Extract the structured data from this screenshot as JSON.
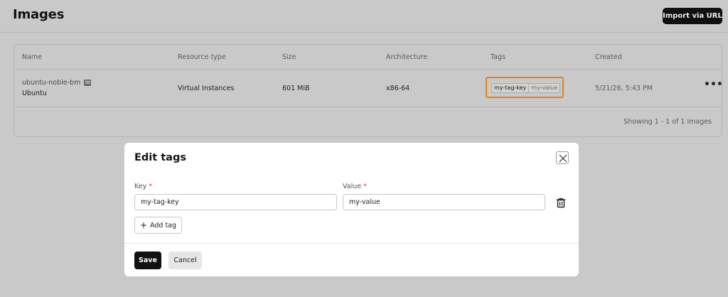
{
  "header": {
    "title": "Images",
    "import_button": "Import via URL"
  },
  "table": {
    "columns": [
      "Name",
      "Resource type",
      "Size",
      "Architecture",
      "Tags",
      "Created"
    ],
    "rows": [
      {
        "name": "ubuntu-noble-bm",
        "id_icon": "ID",
        "subtitle": "Ubuntu",
        "resource_type": "Virtual Instances",
        "size": "601 MiB",
        "architecture": "x86-64",
        "tag_key": "my-tag-key",
        "tag_value": "my-value",
        "created": "5/21/26, 5:43 PM"
      }
    ],
    "footer": "Showing 1 - 1 of 1 images",
    "highlight_color": "#e57f1e"
  },
  "modal": {
    "title": "Edit tags",
    "key_label": "Key",
    "value_label": "Value",
    "required_mark": "*",
    "key_value": "my-tag-key",
    "value_value": "my-value",
    "add_tag_label": "Add tag",
    "add_tag_icon": "+",
    "save_label": "Save",
    "cancel_label": "Cancel"
  },
  "icons": {
    "close": "close-icon",
    "trash": "trash-icon",
    "more": "more-icon",
    "plus": "plus-icon",
    "id": "id-badge-icon"
  }
}
